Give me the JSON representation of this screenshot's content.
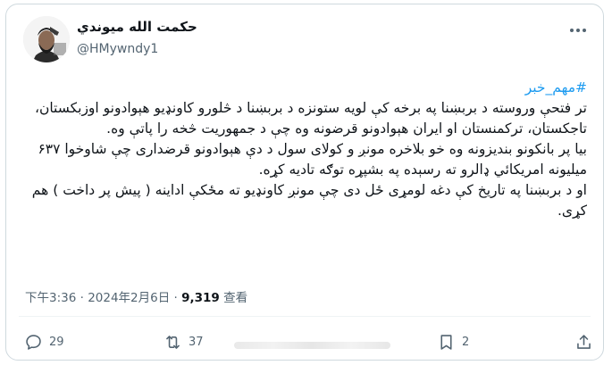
{
  "author": {
    "display_name": "حکمت الله میوندي",
    "handle": "@HMywndy1"
  },
  "post": {
    "hashtag": "#مهم_خبر",
    "paragraphs": [
      "تر فتحې وروسته د بربښنا په برخه کې لویه ستونزه د بربښنا د څلورو کاونډیو هېوادونو اوزبکستان، تاجکستان، ترکمنستان او ایران هېوادونو قرضونه وه چې د جمهوریت څخه را پاتې وه.",
      "بیا پر بانکونو بندیزونه وه خو بلاخره مونږ و کولای سول د دې هېوادونو قرضداری چې شاوخوا ۶۳۷ میلیونه امریکائي ډالرو ته رسېده په بشپړه توګه تادیه کړه.",
      "او د بربښنا په تاریخ کې دغه لومړی ځل دی چې مونږ کاونډیو ته مځکې اداینه ( پیش پر داخت ) هم کړی."
    ]
  },
  "meta": {
    "timestamp": "下午3:36 · 2024年2月6日",
    "separator": "·",
    "views_count": "9,319",
    "views_label": "查看"
  },
  "actions": {
    "reply_count": "29",
    "repost_count": "37",
    "bookmark_count": "2"
  },
  "icons": {
    "more": "more-horizontal-icon",
    "reply": "reply-icon",
    "repost": "repost-icon",
    "bookmark": "bookmark-icon",
    "share": "share-icon"
  },
  "colors": {
    "link": "#1d9bf0",
    "secondary_text": "#536471",
    "border": "#cfd9de"
  }
}
